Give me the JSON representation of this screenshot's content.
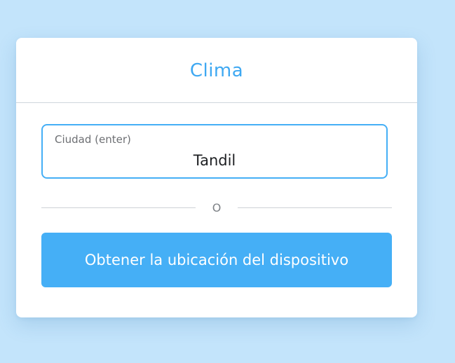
{
  "card": {
    "title": "Clima"
  },
  "city_field": {
    "label": "Ciudad (enter)",
    "value": "Tandil"
  },
  "divider": {
    "text": "O"
  },
  "location_button": {
    "label": "Obtener la ubicación del dispositivo"
  },
  "colors": {
    "background": "#c3e4fb",
    "accent": "#45aff6",
    "title": "#3ea8f2",
    "card": "#ffffff"
  }
}
